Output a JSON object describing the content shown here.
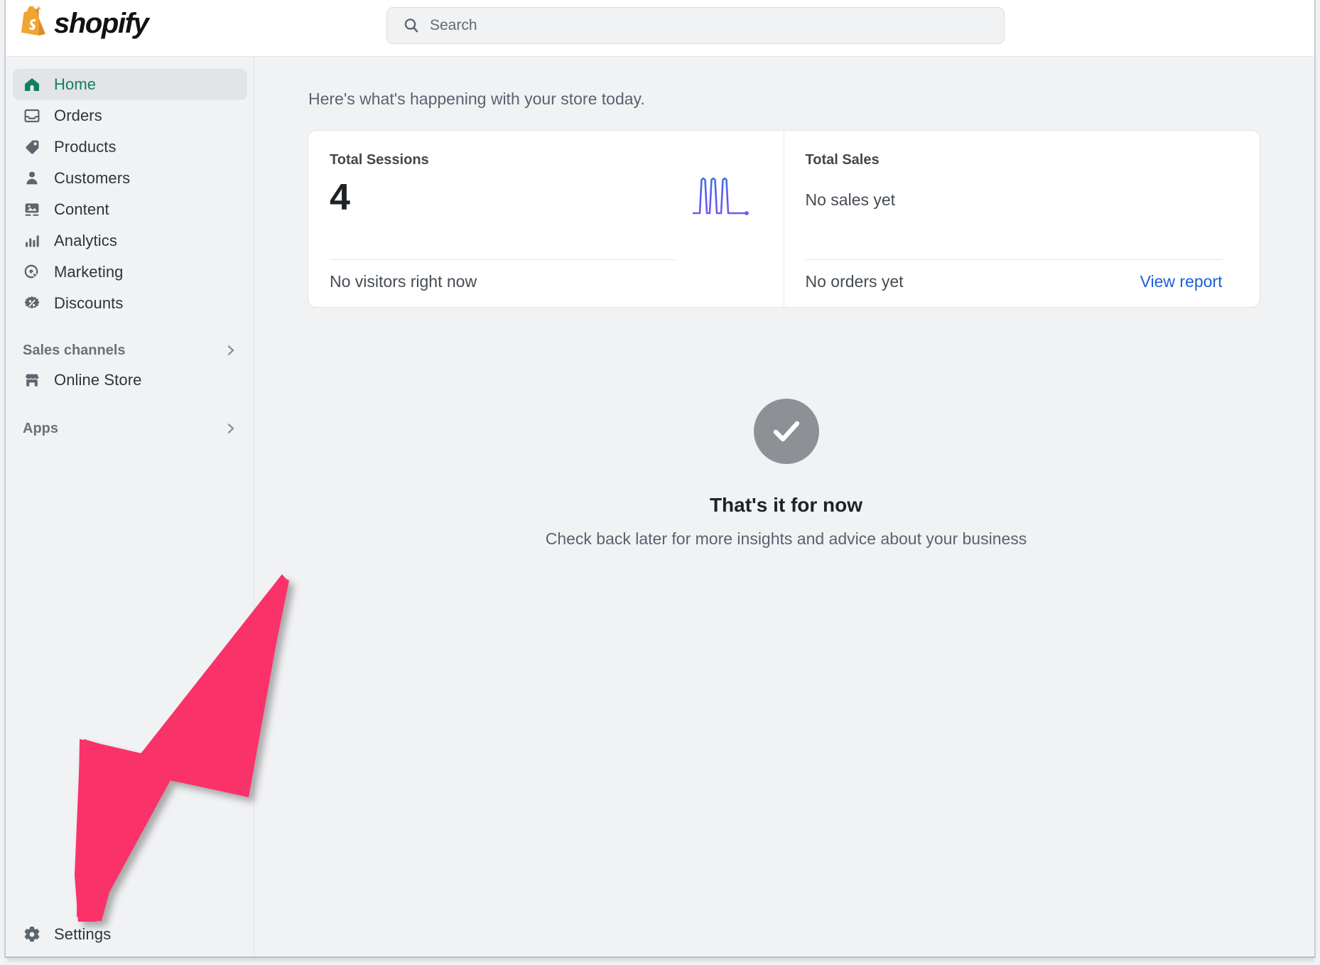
{
  "app": {
    "brand_name": "shopify",
    "brand_icon": "shopify-bag-icon"
  },
  "search": {
    "placeholder": "Search",
    "icon": "search-icon"
  },
  "sidebar": {
    "items": [
      {
        "label": "Home",
        "icon": "home-icon",
        "active": true
      },
      {
        "label": "Orders",
        "icon": "orders-icon",
        "active": false
      },
      {
        "label": "Products",
        "icon": "tag-icon",
        "active": false
      },
      {
        "label": "Customers",
        "icon": "person-icon",
        "active": false
      },
      {
        "label": "Content",
        "icon": "image-icon",
        "active": false
      },
      {
        "label": "Analytics",
        "icon": "bar-chart-icon",
        "active": false
      },
      {
        "label": "Marketing",
        "icon": "target-icon",
        "active": false
      },
      {
        "label": "Discounts",
        "icon": "discount-icon",
        "active": false
      }
    ],
    "sales_channels": {
      "title": "Sales channels",
      "chevron": "chevron-right-icon",
      "items": [
        {
          "label": "Online Store",
          "icon": "storefront-icon"
        }
      ]
    },
    "apps": {
      "title": "Apps",
      "chevron": "chevron-right-icon"
    },
    "settings": {
      "label": "Settings",
      "icon": "gear-icon"
    }
  },
  "main": {
    "greeting": "Here's what's happening with your store today.",
    "cards": {
      "sessions": {
        "title": "Total Sessions",
        "value": "4",
        "footer": "No visitors right now"
      },
      "sales": {
        "title": "Total Sales",
        "value": "No sales yet",
        "footer": "No orders yet",
        "link": "View report"
      }
    },
    "empty_state": {
      "icon": "check-circle-icon",
      "title": "That's it for now",
      "subtitle": "Check back later for more insights and advice about your business"
    }
  },
  "annotation": {
    "type": "arrow",
    "points_to": "Settings",
    "color": "#f9326b"
  },
  "colors": {
    "accent_green": "#0f7f62",
    "link_blue": "#1c5fd6",
    "brand_orange": "#f5a623",
    "sparkline_blue": "#3d72e8",
    "sparkline_purple": "#7a5bf0",
    "annotation_pink": "#f9326b",
    "empty_gray": "#8d9196",
    "sidebar_bg": "#f1f2f4"
  },
  "chart_data": {
    "type": "line",
    "title": "Total Sessions sparkline",
    "x": [
      0,
      1,
      2,
      3,
      4,
      5,
      6,
      7,
      8,
      9,
      10,
      11,
      12,
      13,
      14,
      15,
      16,
      17,
      18,
      19
    ],
    "values": [
      0,
      0,
      0,
      0,
      1,
      0,
      0,
      1,
      0,
      0,
      1,
      0,
      0,
      0,
      0,
      0,
      0,
      0,
      0,
      0
    ],
    "xlabel": "",
    "ylabel": "",
    "ylim": [
      0,
      1
    ],
    "grid": false,
    "legend": "none",
    "annotations": [
      "end-point marker at last data point"
    ]
  }
}
